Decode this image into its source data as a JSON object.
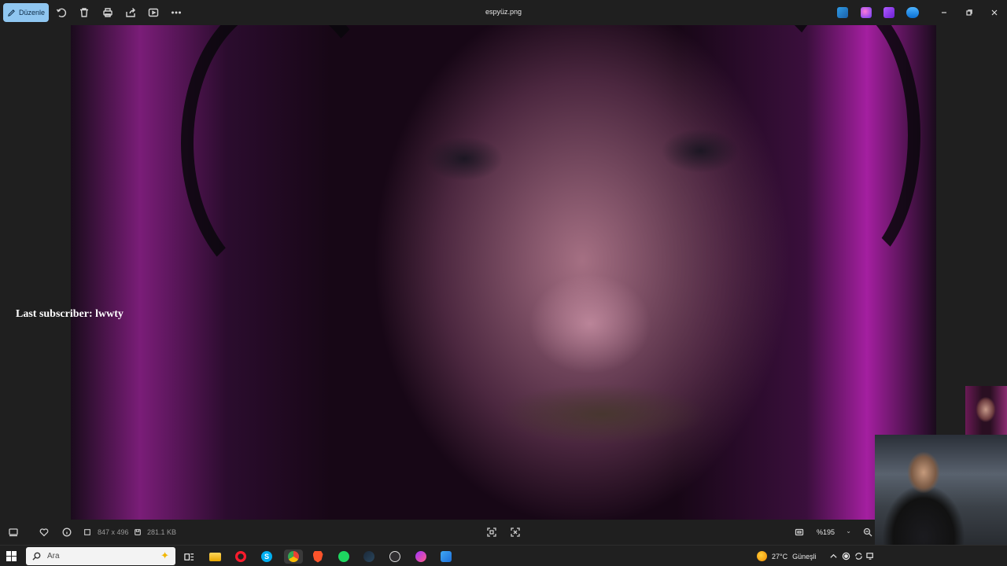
{
  "window": {
    "title": "espyüz.png",
    "edit_label": "Düzenle"
  },
  "toolbar_icons": [
    "rotate-icon",
    "delete-icon",
    "print-icon",
    "share-icon",
    "slideshow-icon",
    "more-icon"
  ],
  "overlay": {
    "last_subscriber": "Last subscriber: lwwty"
  },
  "status": {
    "dimensions": "847 x 496",
    "file_size": "281.1 KB",
    "zoom": "%195"
  },
  "taskbar": {
    "search_placeholder": "Ara",
    "weather_temp": "27°C",
    "weather_desc": "Güneşli",
    "apps": [
      "task-view",
      "file-explorer",
      "opera",
      "skype",
      "chrome",
      "brave",
      "spotify",
      "steam",
      "obs",
      "messenger",
      "paint"
    ]
  },
  "colors": {
    "accent": "#8fc6f0",
    "background": "#1f1f1f",
    "taskbar": "#202020"
  }
}
